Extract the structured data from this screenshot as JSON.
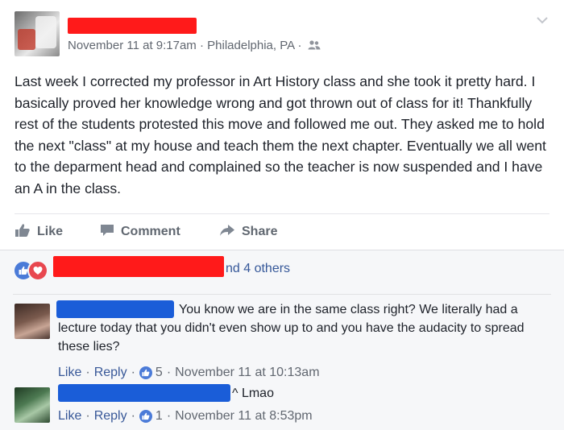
{
  "post": {
    "date": "November 11 at 9:17am",
    "location": "Philadelphia, PA",
    "audience_icon": "friends-icon",
    "text": "Last week I corrected my professor in Art History class and she took it pretty hard. I basically proved her knowledge wrong and got thrown out of class for it! Thankfully rest of the students protested this move and followed me out. They asked me to hold the next \"class\" at my house and teach them the next chapter. Eventually we all went to the deparment head and complained so the teacher is now suspended and I have an A in the class."
  },
  "actions": {
    "like": "Like",
    "comment": "Comment",
    "share": "Share"
  },
  "reactions": {
    "summary_suffix": "nd 4 others",
    "types": [
      "like-icon",
      "love-icon"
    ]
  },
  "comments": [
    {
      "text": "You know we are in the same class right? We literally had a lecture today that you didn't even show up to and you have the audacity to spread these lies?",
      "like_label": "Like",
      "reply_label": "Reply",
      "like_count": "5",
      "time": "November 11 at 10:13am"
    },
    {
      "text": "^ Lmao",
      "like_label": "Like",
      "reply_label": "Reply",
      "like_count": "1",
      "time": "November 11 at 8:53pm"
    }
  ],
  "colors": {
    "redaction_red": "#ff1a1a",
    "redaction_blue": "#1a5dd8",
    "link_blue": "#385898",
    "like_blue": "#4b7bd8",
    "love_red": "#e8474f"
  }
}
